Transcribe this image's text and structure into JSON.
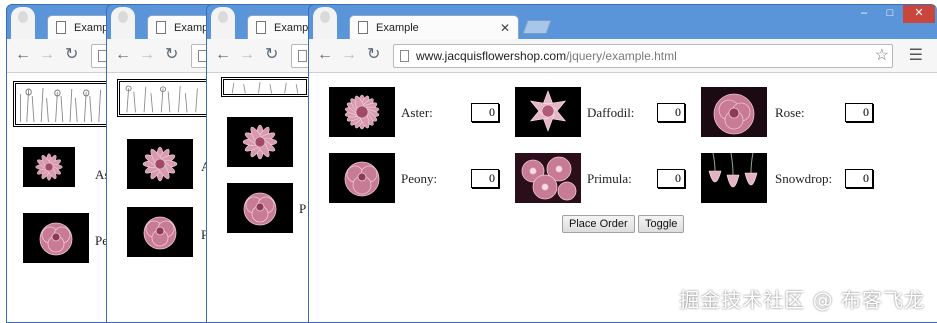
{
  "browser": {
    "tab_title_short": "Example",
    "tab_title": "Example",
    "url_host": "www.jacquisflowershop.com",
    "url_path": "/jquery/example.html",
    "window_controls": {
      "minimize": "–",
      "maximize": "□",
      "close": "✕"
    }
  },
  "narrow_windows": [
    {
      "labels": [
        "As",
        "Pe"
      ]
    },
    {
      "labels": [
        "A",
        "P"
      ]
    },
    {
      "labels": [
        "P"
      ]
    }
  ],
  "products": [
    {
      "name": "Aster:",
      "quantity": "0",
      "image": "aster"
    },
    {
      "name": "Daffodil:",
      "quantity": "0",
      "image": "daffodil"
    },
    {
      "name": "Rose:",
      "quantity": "0",
      "image": "rose"
    },
    {
      "name": "Peony:",
      "quantity": "0",
      "image": "peony"
    },
    {
      "name": "Primula:",
      "quantity": "0",
      "image": "primula"
    },
    {
      "name": "Snowdrop:",
      "quantity": "0",
      "image": "snowdrop"
    }
  ],
  "buttons": {
    "place_order": "Place Order",
    "toggle": "Toggle"
  },
  "icons": {
    "back": "arrow-left-icon",
    "forward": "arrow-right-icon",
    "reload": "reload-icon",
    "star": "star-icon",
    "menu": "menu-icon",
    "page": "page-icon"
  },
  "colors": {
    "window_frame": "#5b95d9",
    "close_button": "#c9463d",
    "flower_pink": "#c77b95"
  },
  "watermark": "掘金技术社区 @ 布客飞龙"
}
